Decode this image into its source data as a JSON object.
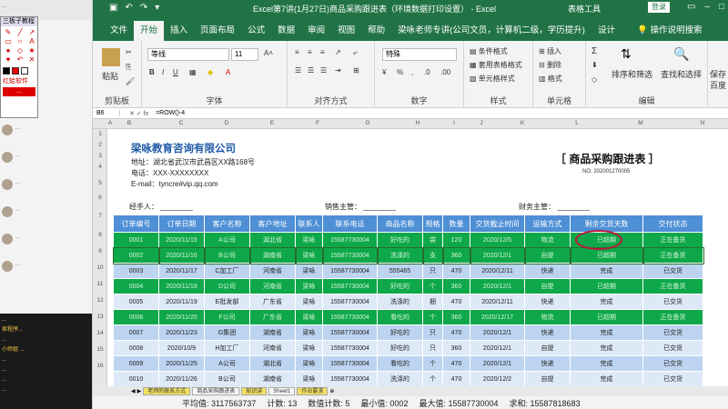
{
  "left": {
    "top_text": "...",
    "tool_title": "三板子教程",
    "tool_label": "红蛤软件",
    "tool_button": "...",
    "chats": [
      "...",
      "...",
      "...",
      "...",
      "...",
      "...",
      "...",
      "..."
    ],
    "live": [
      "...",
      "家程序...",
      "...",
      "小师姐 ...",
      "...",
      "...",
      "...",
      "..."
    ]
  },
  "excel": {
    "title": "Excel第7讲(1月27日)商品采购跟进表（环境数据打印设置） - Excel",
    "table_tools": "表格工具",
    "login": "登录",
    "tabs": [
      "文件",
      "开始",
      "插入",
      "页面布局",
      "公式",
      "数据",
      "审阅",
      "视图",
      "帮助",
      "梁咏老师专讲(公司文员，计算机二级，学历提升)",
      "设计"
    ],
    "tell_me": "操作说明搜索",
    "ribbon": {
      "paste": "粘贴",
      "clipboard": "剪贴板",
      "font_name": "等线",
      "font_size": "11",
      "font": "字体",
      "align": "对齐方式",
      "number_format": "特殊",
      "number": "数字",
      "cond_format": "条件格式",
      "table_format": "套用表格格式",
      "cell_style": "单元格样式",
      "style": "样式",
      "insert": "插入",
      "delete": "删除",
      "format": "格式",
      "cells": "单元格",
      "sort": "排序和筛选",
      "find": "查找和选择",
      "edit": "编辑",
      "save_label": "保存",
      "save_sub": "百度"
    },
    "name_box": "B6",
    "formula": "=ROW()-4",
    "columns": [
      "A",
      "B",
      "C",
      "D",
      "E",
      "F",
      "G",
      "H",
      "I",
      "J",
      "K",
      "L",
      "M",
      "N"
    ],
    "rows": [
      "1",
      "2",
      "3",
      "4",
      "5",
      "6",
      "7",
      "8",
      "9",
      "10",
      "11",
      "12",
      "13",
      "14",
      "15",
      "16"
    ],
    "company": "梁咏教育咨询有限公司",
    "address": "地址：湖北省武汉市武昌区XX路168号",
    "phone": "电话：XXX-XXXXXXXX",
    "email": "E-mail：tyncre#vip.qq.com",
    "doc_title": "［ 商品采购跟进表 ］",
    "doc_no": "NO.   202001270005",
    "handler": "经手人：",
    "sales_mgr": "销售主管：",
    "biz_mgr": "财务主管：",
    "headers": [
      "订单编号",
      "订单日期",
      "客户名称",
      "客户地址",
      "联系人",
      "联系电话",
      "商品名称",
      "规格",
      "数量",
      "交货截止时间",
      "运输方式",
      "剩余交货天数",
      "交付状态"
    ],
    "data": [
      [
        "0001",
        "2020/11/15",
        "A公司",
        "湖北省",
        "梁咏",
        "15587730004",
        "好吃的",
        "袋",
        "120",
        "2020/12/5",
        "物流",
        "已超期",
        "正在备货"
      ],
      [
        "0002",
        "2020/11/16",
        "B公司",
        "湖南省",
        "梁咏",
        "15587730004",
        "洗涤的",
        "支",
        "360",
        "2020/12/1",
        "自提",
        "已超期",
        "正在备货"
      ],
      [
        "0003",
        "2020/11/17",
        "C加工厂",
        "河南省",
        "梁咏",
        "15587730004",
        "555465",
        "只",
        "470",
        "2020/12/11",
        "快递",
        "完成",
        "已交货"
      ],
      [
        "0004",
        "2020/11/18",
        "D公司",
        "河南省",
        "梁咏",
        "15587730004",
        "好吃的",
        "个",
        "360",
        "2020/12/1",
        "自提",
        "已超期",
        "正在备货"
      ],
      [
        "0005",
        "2020/11/19",
        "E批发部",
        "广东省",
        "梁咏",
        "15587730004",
        "洗涤的",
        "捆",
        "470",
        "2020/12/11",
        "快递",
        "完成",
        "已交货"
      ],
      [
        "0006",
        "2020/11/20",
        "F公司",
        "广东省",
        "梁咏",
        "15587730004",
        "看吃的",
        "个",
        "360",
        "2020/12/17",
        "物流",
        "已超期",
        "正在备货"
      ],
      [
        "0007",
        "2020/11/23",
        "G集团",
        "湖南省",
        "梁咏",
        "15587730004",
        "好吃的",
        "只",
        "470",
        "2020/12/1",
        "快递",
        "完成",
        "已交货"
      ],
      [
        "0008",
        "2020/10/9",
        "H加工厂",
        "河南省",
        "梁咏",
        "15587730004",
        "好吃的",
        "只",
        "360",
        "2020/12/1",
        "自提",
        "完成",
        "已交货"
      ],
      [
        "0009",
        "2020/11/25",
        "A公司",
        "湖北省",
        "梁咏",
        "15587730004",
        "看吃的",
        "个",
        "470",
        "2020/12/1",
        "快递",
        "完成",
        "已交货"
      ],
      [
        "0010",
        "2020/11/26",
        "B公司",
        "湖南省",
        "梁咏",
        "15587730004",
        "洗涤的",
        "个",
        "470",
        "2020/12/2",
        "自提",
        "完成",
        "已交货"
      ]
    ],
    "sheet_tabs": [
      "老师的联系方式",
      "商品采购跟进表",
      "知识讲",
      "Sheet1",
      "作业要求"
    ],
    "status": {
      "avg": "平均值: 3117563737",
      "count": "计数: 13",
      "numcount": "数值计数: 5",
      "min": "最小值: 0002",
      "max": "最大值: 15587730004",
      "sum": "求和: 15587818683"
    }
  }
}
